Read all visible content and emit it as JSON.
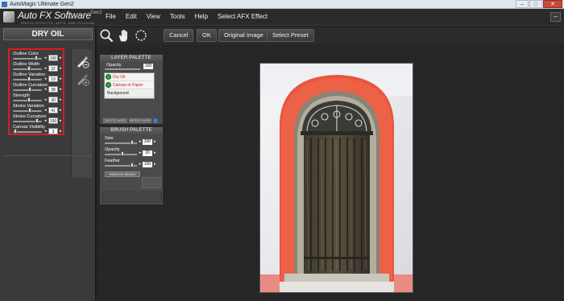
{
  "window": {
    "title": "AutoMagic Ultimate Gen2",
    "buttons": {
      "minimize": "–",
      "maximize": "□",
      "close": "✕"
    }
  },
  "app": {
    "logo_name": "Auto FX Software",
    "logo_version": "Gen2",
    "logo_tagline": "PHOTO EFFECTS, APPS, AND PLUGINS"
  },
  "menu": [
    "File",
    "Edit",
    "View",
    "Tools",
    "Help",
    "Select AFX Effect"
  ],
  "header_minus": "–",
  "toolbar": {
    "icons": [
      "zoom-icon",
      "hand-icon",
      "rotate-icon"
    ],
    "buttons": {
      "cancel": "Cancel",
      "ok": "OK",
      "original_image": "Original Image",
      "select_preset": "Select Preset"
    }
  },
  "effect": {
    "title": "DRY OIL",
    "sliders": [
      {
        "label": "Outline Color",
        "value": "100",
        "level": 0.85
      },
      {
        "label": "Outline Width",
        "value": "32",
        "level": 0.55
      },
      {
        "label": "Outline Variation",
        "value": "19",
        "level": 0.55
      },
      {
        "label": "Outline Curvature",
        "value": "38",
        "level": 0.6
      },
      {
        "label": "Strength",
        "value": "30",
        "level": 0.55
      },
      {
        "label": "Stroke Variation",
        "value": "41",
        "level": 0.6
      },
      {
        "label": "Stroke Curvature",
        "value": "100",
        "level": 0.88
      },
      {
        "label": "Canvas Visibility",
        "value": "3",
        "level": 0.04
      }
    ]
  },
  "layer_palette": {
    "title": "LAYER PALETTE",
    "opacity_label": "Opacity",
    "opacity_value": "100",
    "layers": [
      "Dry Oil",
      "Canvas or Paper",
      "Background"
    ],
    "delete_button": "DELETE LAYER",
    "merge_button": "MERGE LAYER"
  },
  "brush_palette": {
    "title": "BRUSH PALETTE",
    "sliders": [
      {
        "label": "Size",
        "value": "200",
        "level": 0.9
      },
      {
        "label": "Opacity",
        "value": "20",
        "level": 0.55
      },
      {
        "label": "Feather",
        "value": "100",
        "level": 0.9
      }
    ],
    "remove_button": "REMOVE BRUSH"
  },
  "colors": {
    "highlight_red": "#d81e1e",
    "panel": "#3a3a3a",
    "workspace": "#232323",
    "layer_text": "#c8161c"
  }
}
